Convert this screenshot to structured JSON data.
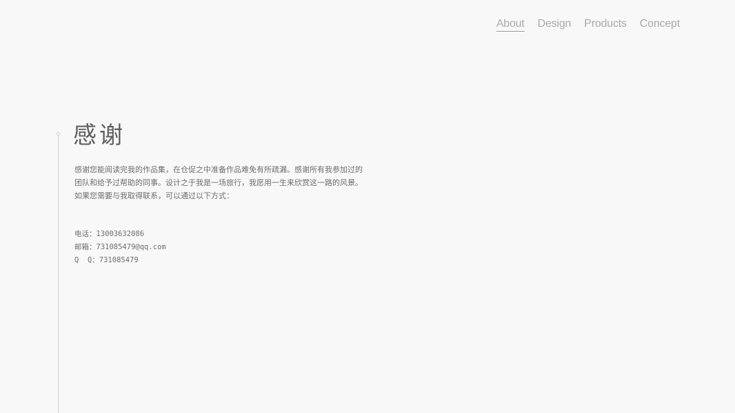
{
  "nav": {
    "items": [
      {
        "label": "About",
        "active": true
      },
      {
        "label": "Design",
        "active": false
      },
      {
        "label": "Products",
        "active": false
      },
      {
        "label": "Concept",
        "active": false
      }
    ]
  },
  "page": {
    "title": "感谢",
    "intro_lines": [
      "感谢您能阅读完我的作品集，在仓促之中准备作品难免有所疏漏。感谢所有我参加过的",
      "团队和给予过帮助的同事。设计之于我是一场旅行，我愿用一生来欣赏这一路的风景。",
      "如果您需要与我取得联系，可以通过以下方式："
    ]
  },
  "contact": {
    "phone": "电话：13003632086",
    "email": "邮箱：731085479@qq.com",
    "qq": "Q  Q：731085479"
  },
  "colors": {
    "background": "#f8f8f8",
    "nav_text": "#a9a9a9",
    "body_text": "#6e6e6e",
    "rule": "#cfcfcf"
  }
}
